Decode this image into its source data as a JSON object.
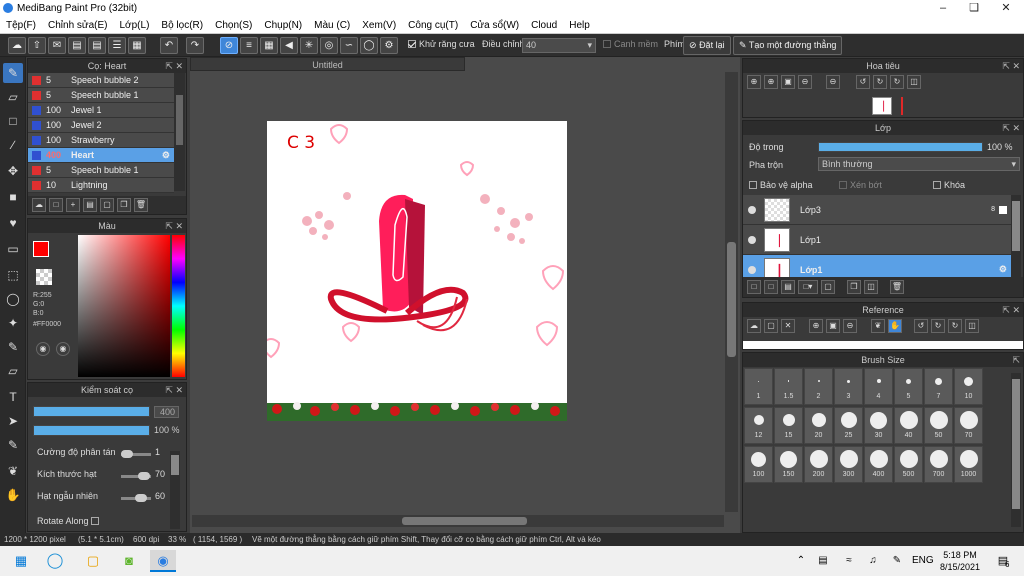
{
  "window": {
    "title": "MediBang Paint Pro (32bit)"
  },
  "menu": [
    "Tệp(F)",
    "Chỉnh sửa(E)",
    "Lớp(L)",
    "Bộ lọc(R)",
    "Chọn(S)",
    "Chụp(N)",
    "Màu (C)",
    "Xem(V)",
    "Công cụ(T)",
    "Cửa sổ(W)",
    "Cloud",
    "Help"
  ],
  "toolbar": {
    "antialias_label": "Khử răng cưa",
    "adjust_label": "Điều chỉnh",
    "adjust_value": "40",
    "margin_label": "Canh mềm",
    "key_label": "Phím",
    "reset_label": "Đặt lại",
    "line_label": "Tạo một đường thẳng"
  },
  "layers_mini": {
    "title": "Cọ: Heart",
    "rows": [
      {
        "op": "5",
        "name": "Speech bubble 2",
        "color": "#e03030"
      },
      {
        "op": "5",
        "name": "Speech bubble 1",
        "color": "#e03030"
      },
      {
        "op": "100",
        "name": "Jewel 1",
        "color": "#3050d0"
      },
      {
        "op": "100",
        "name": "Jewel 2",
        "color": "#3050d0"
      },
      {
        "op": "100",
        "name": "Strawberry",
        "color": "#3050d0"
      },
      {
        "op": "400",
        "name": "Heart",
        "color": "#3050d0"
      },
      {
        "op": "5",
        "name": "Speech bubble 1",
        "color": "#e03030"
      },
      {
        "op": "10",
        "name": "Lightning",
        "color": "#e03030"
      }
    ]
  },
  "color_panel": {
    "title": "Màu",
    "r": "R:255",
    "g": "G:0",
    "b": "B:0",
    "hex": "#FF0000",
    "fg": "#ff0000"
  },
  "brush_control": {
    "title": "Kiểm soát cọ",
    "size_value": "400",
    "opacity_value": "100 %",
    "size_fill": 1.0,
    "opacity_fill": 1.0,
    "params": [
      {
        "label": "Cường độ phân tán",
        "value": "1",
        "level": 0.01
      },
      {
        "label": "Kích thước hạt",
        "value": "70",
        "level": 0.7
      },
      {
        "label": "Hạt ngẫu nhiên",
        "value": "60",
        "level": 0.6
      }
    ],
    "rotate_label": "Rotate Along"
  },
  "document": {
    "tab_title": "Untitled",
    "canvas_text": "C 3"
  },
  "navigator": {
    "title": "Hoa tiêu"
  },
  "layer_panel": {
    "title": "Lớp",
    "opacity_label": "Độ trong",
    "opacity_value": "100 %",
    "opacity_fill": 1.0,
    "blend_label": "Pha trộn",
    "blend_value": "Bình thường",
    "protect_alpha": "Bảo vệ alpha",
    "clipping": "Xén bớt",
    "lock": "Khóa",
    "layers": [
      {
        "name": "Lớp3",
        "badge": "8"
      },
      {
        "name": "Lớp1",
        "badge": ""
      },
      {
        "name": "Lớp1",
        "badge": ""
      }
    ]
  },
  "reference": {
    "title": "Reference"
  },
  "brush_size": {
    "title": "Brush Size",
    "sizes": [
      "1",
      "1.5",
      "2",
      "3",
      "4",
      "5",
      "7",
      "10",
      "12",
      "15",
      "20",
      "25",
      "30",
      "40",
      "50",
      "70",
      "100",
      "150",
      "200",
      "300",
      "400",
      "500",
      "700",
      "1000"
    ]
  },
  "status": {
    "size": "1200 * 1200 pixel",
    "cm": "(5.1 * 5.1cm)",
    "dpi": "600 dpi",
    "zoom": "33 %",
    "coords": "( 1154, 1569 )",
    "hint": "Vẽ một đường thẳng bằng cách giữ phím Shift, Thay đổi cỡ cọ bằng cách giữ phím Ctrl, Alt và kéo"
  },
  "taskbar": {
    "lang": "ENG",
    "time": "5:18 PM",
    "date": "8/15/2021",
    "notif": "6"
  }
}
